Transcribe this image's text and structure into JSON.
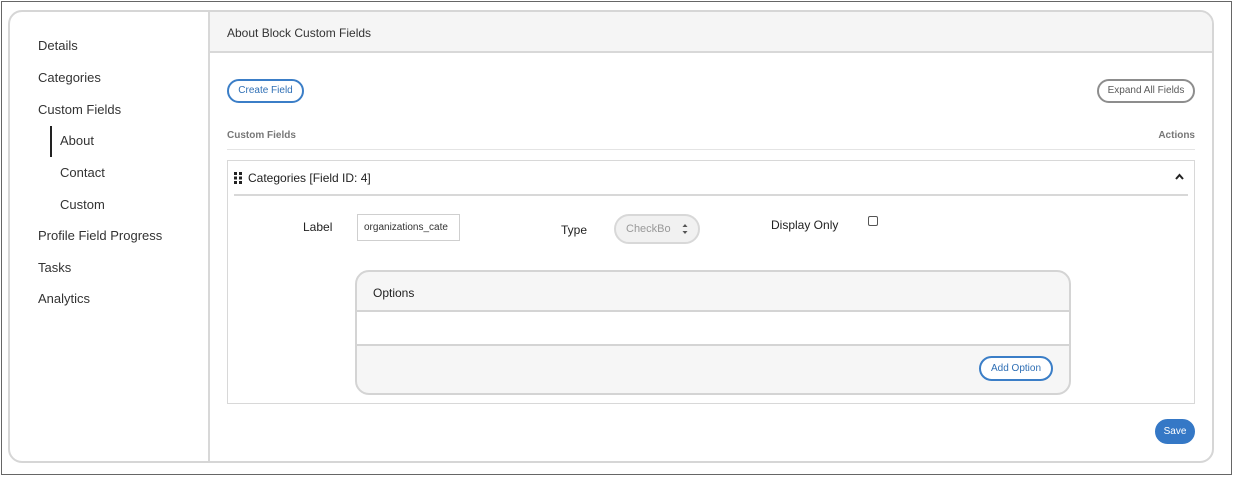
{
  "sidebar": {
    "items": [
      {
        "label": "Details"
      },
      {
        "label": "Categories"
      },
      {
        "label": "Custom Fields"
      },
      {
        "label": "Profile Field Progress"
      },
      {
        "label": "Tasks"
      },
      {
        "label": "Analytics"
      }
    ],
    "sub_items": [
      {
        "label": "About",
        "active": true
      },
      {
        "label": "Contact"
      },
      {
        "label": "Custom"
      }
    ]
  },
  "header": {
    "title": "About Block Custom Fields"
  },
  "toolbar": {
    "create_field_label": "Create Field",
    "expand_all_label": "Expand All Fields"
  },
  "table": {
    "col_custom_fields": "Custom Fields",
    "col_actions": "Actions"
  },
  "field": {
    "title": "Categories [Field ID: 4]",
    "label_caption": "Label",
    "label_value": "organizations_cate",
    "type_caption": "Type",
    "type_value": "CheckBo",
    "display_only_caption": "Display Only",
    "display_only_checked": false
  },
  "options": {
    "title": "Options",
    "add_option_label": "Add Option"
  },
  "footer": {
    "save_label": "Save"
  },
  "colors": {
    "accent": "#3578c6",
    "border": "#d8d8d8",
    "header_bg": "#f5f5f5"
  },
  "icons": {
    "drag": "drag-handle-icon",
    "collapse": "chevron-up-icon",
    "select": "sort-arrows-icon"
  }
}
